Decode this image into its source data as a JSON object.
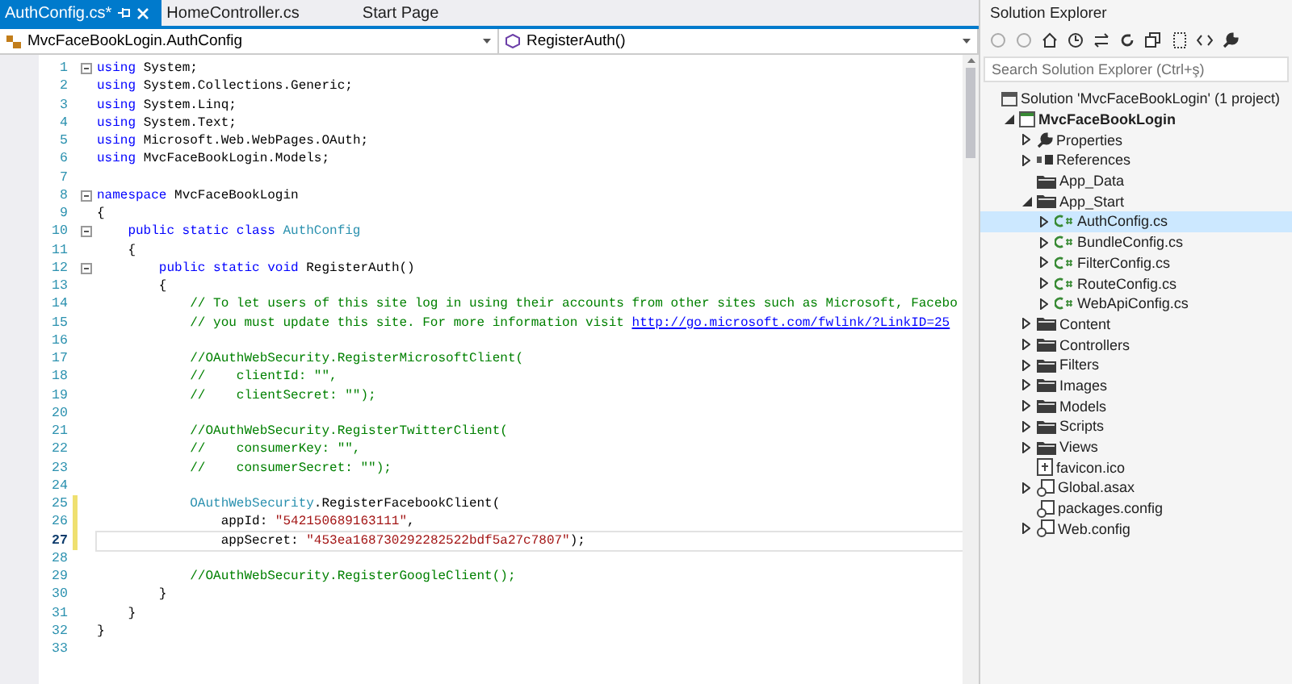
{
  "editor": {
    "tabs": [
      {
        "label": "AuthConfig.cs*",
        "selected": true
      },
      {
        "label": "HomeController.cs",
        "selected": false
      },
      {
        "label": "Start Page",
        "selected": false
      }
    ],
    "navigation": {
      "type_dropdown": "MvcFaceBookLogin.AuthConfig",
      "member_dropdown": "RegisterAuth()"
    },
    "lines": [
      {
        "number": "1",
        "foldable": true,
        "changed": false,
        "current": false,
        "segments": [
          {
            "kind": "keyword",
            "text": "using"
          },
          {
            "kind": "plain",
            "text": " System;"
          }
        ]
      },
      {
        "number": "2",
        "foldable": false,
        "changed": false,
        "current": false,
        "segments": [
          {
            "kind": "keyword",
            "text": "using"
          },
          {
            "kind": "plain",
            "text": " System.Collections.Generic;"
          }
        ]
      },
      {
        "number": "3",
        "foldable": false,
        "changed": false,
        "current": false,
        "segments": [
          {
            "kind": "keyword",
            "text": "using"
          },
          {
            "kind": "plain",
            "text": " System.Linq;"
          }
        ]
      },
      {
        "number": "4",
        "foldable": false,
        "changed": false,
        "current": false,
        "segments": [
          {
            "kind": "keyword",
            "text": "using"
          },
          {
            "kind": "plain",
            "text": " System.Text;"
          }
        ]
      },
      {
        "number": "5",
        "foldable": false,
        "changed": false,
        "current": false,
        "segments": [
          {
            "kind": "keyword",
            "text": "using"
          },
          {
            "kind": "plain",
            "text": " Microsoft.Web.WebPages.OAuth;"
          }
        ]
      },
      {
        "number": "6",
        "foldable": false,
        "changed": false,
        "current": false,
        "segments": [
          {
            "kind": "keyword",
            "text": "using"
          },
          {
            "kind": "plain",
            "text": " MvcFaceBookLogin.Models;"
          }
        ]
      },
      {
        "number": "7",
        "foldable": false,
        "changed": false,
        "current": false
      },
      {
        "number": "8",
        "foldable": true,
        "changed": false,
        "current": false,
        "segments": [
          {
            "kind": "keyword",
            "text": "namespace"
          },
          {
            "kind": "plain",
            "text": " MvcFaceBookLogin"
          }
        ]
      },
      {
        "number": "9",
        "foldable": false,
        "changed": false,
        "current": false,
        "segments": [
          {
            "kind": "plain",
            "text": "{"
          }
        ]
      },
      {
        "number": "10",
        "foldable": true,
        "changed": false,
        "current": false,
        "segments": [
          {
            "kind": "keyword",
            "text": "    public static class"
          },
          {
            "kind": "type",
            "text": " AuthConfig"
          }
        ]
      },
      {
        "number": "11",
        "foldable": false,
        "changed": false,
        "current": false,
        "segments": [
          {
            "kind": "plain",
            "text": "    {"
          }
        ]
      },
      {
        "number": "12",
        "foldable": true,
        "changed": false,
        "current": false,
        "segments": [
          {
            "kind": "keyword",
            "text": "        public static void"
          },
          {
            "kind": "plain",
            "text": " RegisterAuth()"
          }
        ]
      },
      {
        "number": "13",
        "foldable": false,
        "changed": false,
        "current": false,
        "segments": [
          {
            "kind": "plain",
            "text": "        {"
          }
        ]
      },
      {
        "number": "14",
        "foldable": false,
        "changed": false,
        "current": false,
        "segments": [
          {
            "kind": "comment",
            "text": "            // To let users of this site log in using their accounts from other sites such as Microsoft, Facebo"
          }
        ]
      },
      {
        "number": "15",
        "foldable": false,
        "changed": false,
        "current": false,
        "segments": [
          {
            "kind": "comment",
            "text": "            // you must update this site. For more information visit "
          },
          {
            "kind": "link",
            "text": "http://go.microsoft.com/fwlink/?LinkID=25"
          }
        ]
      },
      {
        "number": "16",
        "foldable": false,
        "changed": false,
        "current": false
      },
      {
        "number": "17",
        "foldable": false,
        "changed": false,
        "current": false,
        "segments": [
          {
            "kind": "comment",
            "text": "            //OAuthWebSecurity.RegisterMicrosoftClient("
          }
        ]
      },
      {
        "number": "18",
        "foldable": false,
        "changed": false,
        "current": false,
        "segments": [
          {
            "kind": "comment",
            "text": "            //    clientId: \"\","
          }
        ]
      },
      {
        "number": "19",
        "foldable": false,
        "changed": false,
        "current": false,
        "segments": [
          {
            "kind": "comment",
            "text": "            //    clientSecret: \"\");"
          }
        ]
      },
      {
        "number": "20",
        "foldable": false,
        "changed": false,
        "current": false
      },
      {
        "number": "21",
        "foldable": false,
        "changed": false,
        "current": false,
        "segments": [
          {
            "kind": "comment",
            "text": "            //OAuthWebSecurity.RegisterTwitterClient("
          }
        ]
      },
      {
        "number": "22",
        "foldable": false,
        "changed": false,
        "current": false,
        "segments": [
          {
            "kind": "comment",
            "text": "            //    consumerKey: \"\","
          }
        ]
      },
      {
        "number": "23",
        "foldable": false,
        "changed": false,
        "current": false,
        "segments": [
          {
            "kind": "comment",
            "text": "            //    consumerSecret: \"\");"
          }
        ]
      },
      {
        "number": "24",
        "foldable": false,
        "changed": false,
        "current": false
      },
      {
        "number": "25",
        "foldable": false,
        "changed": true,
        "current": false,
        "segments": [
          {
            "kind": "type",
            "text": "            OAuthWebSecurity"
          },
          {
            "kind": "plain",
            "text": ".RegisterFacebookClient("
          }
        ]
      },
      {
        "number": "26",
        "foldable": false,
        "changed": true,
        "current": false,
        "segments": [
          {
            "kind": "plain",
            "text": "                appId: "
          },
          {
            "kind": "string",
            "text": "\"542150689163111\""
          },
          {
            "kind": "plain",
            "text": ","
          }
        ]
      },
      {
        "number": "27",
        "foldable": false,
        "changed": true,
        "current": true,
        "segments": [
          {
            "kind": "plain",
            "text": "                appSecret: "
          },
          {
            "kind": "string",
            "text": "\"453ea168730292282522bdf5a27c7807\""
          },
          {
            "kind": "plain",
            "text": ");"
          }
        ]
      },
      {
        "number": "28",
        "foldable": false,
        "changed": false,
        "current": false
      },
      {
        "number": "29",
        "foldable": false,
        "changed": false,
        "current": false,
        "segments": [
          {
            "kind": "comment",
            "text": "            //OAuthWebSecurity.RegisterGoogleClient();"
          }
        ]
      },
      {
        "number": "30",
        "foldable": false,
        "changed": false,
        "current": false,
        "segments": [
          {
            "kind": "plain",
            "text": "        }"
          }
        ]
      },
      {
        "number": "31",
        "foldable": false,
        "changed": false,
        "current": false,
        "segments": [
          {
            "kind": "plain",
            "text": "    }"
          }
        ]
      },
      {
        "number": "32",
        "foldable": false,
        "changed": false,
        "current": false,
        "segments": [
          {
            "kind": "plain",
            "text": "}"
          }
        ]
      },
      {
        "number": "33",
        "foldable": false,
        "changed": false,
        "current": false
      }
    ]
  },
  "solution_explorer": {
    "title": "Solution Explorer",
    "search": {
      "placeholder": "Search Solution Explorer (Ctrl+ş)"
    },
    "tree": [
      {
        "kind": "solution",
        "label": "Solution 'MvcFaceBookLogin' (1 project)",
        "selected": false,
        "children": [
          {
            "kind": "project",
            "label": "MvcFaceBookLogin",
            "selected": false,
            "expanded": true,
            "children": [
              {
                "kind": "properties",
                "label": "Properties",
                "selected": false,
                "expanded": false
              },
              {
                "kind": "references",
                "label": "References",
                "selected": false,
                "expanded": false
              },
              {
                "kind": "folder",
                "label": "App_Data",
                "selected": false
              },
              {
                "kind": "folder",
                "label": "App_Start",
                "selected": false,
                "expanded": true,
                "children": [
                  {
                    "kind": "csharp",
                    "label": "AuthConfig.cs",
                    "selected": true,
                    "expanded": false
                  },
                  {
                    "kind": "csharp",
                    "label": "BundleConfig.cs",
                    "selected": false,
                    "expanded": false
                  },
                  {
                    "kind": "csharp",
                    "label": "FilterConfig.cs",
                    "selected": false,
                    "expanded": false
                  },
                  {
                    "kind": "csharp",
                    "label": "RouteConfig.cs",
                    "selected": false,
                    "expanded": false
                  },
                  {
                    "kind": "csharp",
                    "label": "WebApiConfig.cs",
                    "selected": false,
                    "expanded": false
                  }
                ]
              },
              {
                "kind": "folder",
                "label": "Content",
                "selected": false,
                "expanded": false
              },
              {
                "kind": "folder",
                "label": "Controllers",
                "selected": false,
                "expanded": false
              },
              {
                "kind": "folder",
                "label": "Filters",
                "selected": false,
                "expanded": false
              },
              {
                "kind": "folder",
                "label": "Images",
                "selected": false,
                "expanded": false
              },
              {
                "kind": "folder",
                "label": "Models",
                "selected": false,
                "expanded": false
              },
              {
                "kind": "folder",
                "label": "Scripts",
                "selected": false,
                "expanded": false
              },
              {
                "kind": "folder",
                "label": "Views",
                "selected": false,
                "expanded": false
              },
              {
                "kind": "file",
                "label": "favicon.ico",
                "selected": false
              },
              {
                "kind": "config",
                "label": "Global.asax",
                "selected": false,
                "expanded": false
              },
              {
                "kind": "config",
                "label": "packages.config",
                "selected": false
              },
              {
                "kind": "config",
                "label": "Web.config",
                "selected": false,
                "expanded": false
              }
            ]
          }
        ]
      }
    ]
  }
}
